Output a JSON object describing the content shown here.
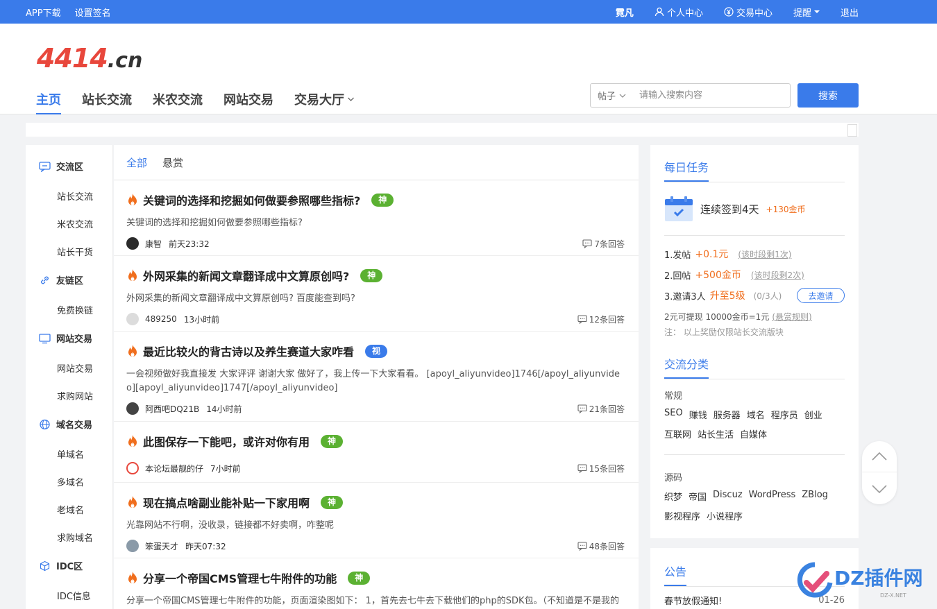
{
  "topbar": {
    "app_download": "APP下载",
    "set_signature": "设置签名",
    "username": "霓凡",
    "personal_center": "个人中心",
    "trade_center": "交易中心",
    "remind": "提醒",
    "logout": "退出"
  },
  "logo": {
    "main": "4414",
    "tld": ".cn"
  },
  "nav": {
    "home": "主页",
    "webmaster": "站长交流",
    "domainer": "米农交流",
    "site_trade": "网站交易",
    "trade_hall": "交易大厅"
  },
  "search": {
    "scope": "帖子",
    "placeholder": "请输入搜索内容",
    "button": "搜索"
  },
  "sidebar": {
    "sections": [
      {
        "title": "交流区",
        "icon": "chat-icon",
        "items": [
          "站长交流",
          "米农交流",
          "站长干货"
        ]
      },
      {
        "title": "友链区",
        "icon": "link-icon",
        "items": [
          "免费换链"
        ]
      },
      {
        "title": "网站交易",
        "icon": "monitor-icon",
        "items": [
          "网站交易",
          "求购网站"
        ]
      },
      {
        "title": "域名交易",
        "icon": "globe-icon",
        "items": [
          "单域名",
          "多域名",
          "老域名",
          "求购域名"
        ]
      },
      {
        "title": "IDC区",
        "icon": "cube-icon",
        "items": [
          "IDC信息"
        ]
      }
    ]
  },
  "tabs": {
    "all": "全部",
    "bounty": "悬赏"
  },
  "posts": [
    {
      "title": "关键词的选择和挖掘如何做要参照哪些指标?",
      "badge": "神",
      "badge_type": "shen",
      "excerpt": "关键词的选择和挖掘如何做要参照哪些指标?",
      "author": "康智",
      "time": "前天23:32",
      "replies": "7条回答",
      "avatar_color": "#2b2b2b"
    },
    {
      "title": "外网采集的新闻文章翻译成中文算原创吗?",
      "badge": "神",
      "badge_type": "shen",
      "excerpt": "外网采集的新闻文章翻译成中文算原创吗? 百度能查到吗?",
      "author": "489250",
      "time": "13小时前",
      "replies": "12条回答",
      "avatar_color": "#dcdcdc"
    },
    {
      "title": "最近比较火的背古诗以及养生赛道大家咋看",
      "badge": "视",
      "badge_type": "shi",
      "excerpt": "一会视频做好我直接发 大家评评 谢谢大家 做好了，我上传一下大家看看。 [apoyl_aliyunvideo]1746[/apoyl_aliyunvideo][apoyl_aliyunvideo]1747[/apoyl_aliyunvideo]",
      "author": "阿西吧DQ21B",
      "time": "14小时前",
      "replies": "21条回答",
      "avatar_color": "#444444"
    },
    {
      "title": "此图保存一下能吧，或许对你有用",
      "badge": "神",
      "badge_type": "shen",
      "excerpt": "",
      "author": "本论坛最靓的仔",
      "time": "7小时前",
      "replies": "15条回答",
      "avatar_color": "#e8473c"
    },
    {
      "title": "现在搞点啥副业能补贴一下家用啊",
      "badge": "神",
      "badge_type": "shen",
      "excerpt": "光靠网站不行啊，没收录，链接都不好卖啊，咋整呢",
      "author": "笨蛋天才",
      "time": "昨天07:32",
      "replies": "48条回答",
      "avatar_color": "#8a9aa8"
    },
    {
      "title": "分享一个帝国CMS管理七牛附件的功能",
      "badge": "神",
      "badge_type": "shen",
      "excerpt": "分享一个帝国CMS管理七牛附件的功能，页面渲染图如下： 1，首先去七牛去下载他们的php的SDK包。（不知道是不是我的",
      "author": "",
      "time": "",
      "replies": "",
      "avatar_color": "#cccccc"
    }
  ],
  "daily_task": {
    "title": "每日任务",
    "checkin_text": "连续签到4天",
    "checkin_reward": "+130金币",
    "tasks": [
      {
        "label": "1.发帖",
        "reward": "+0.1元",
        "note": "(该时段剩1次)"
      },
      {
        "label": "2.回帖",
        "reward": "+500金币",
        "note": "(该时段剩2次)"
      },
      {
        "label": "3.邀请3人",
        "reward": "升至5级",
        "note": "(0/3人)",
        "button": "去邀请"
      }
    ],
    "withdraw_text": "2元可提现 10000金币=1元",
    "rules_link": "(悬赏规则)",
    "note": "注：  以上奖励仅限站长交流版块"
  },
  "categories": {
    "title": "交流分类",
    "groups": [
      {
        "name": "常规",
        "rows": [
          [
            "SEO",
            "赚钱",
            "服务器",
            "域名",
            "程序员",
            "创业"
          ],
          [
            "互联网",
            "站长生活",
            "自媒体"
          ]
        ]
      },
      {
        "name": "源码",
        "rows": [
          [
            "织梦",
            "帝国",
            "Discuz",
            "WordPress",
            "ZBlog"
          ],
          [
            "影视程序",
            "小说程序"
          ]
        ]
      }
    ]
  },
  "announcement": {
    "title": "公告",
    "items": [
      {
        "text": "春节放假通知!",
        "date": "01-26"
      }
    ]
  },
  "watermark": {
    "brand": "DZ插件网",
    "url": "DZ-X.NET"
  },
  "colors": {
    "primary": "#3a7bea",
    "shen_badge": "#5bb132",
    "accent_orange": "#f06e1d",
    "logo_red": "#e8473c"
  }
}
